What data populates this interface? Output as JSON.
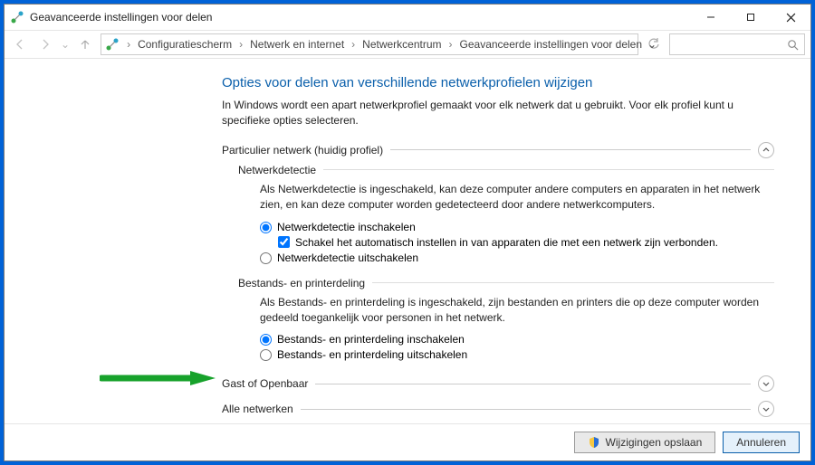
{
  "window": {
    "title": "Geavanceerde instellingen voor delen"
  },
  "breadcrumb": {
    "items": [
      "Configuratiescherm",
      "Netwerk en internet",
      "Netwerkcentrum",
      "Geavanceerde instellingen voor delen"
    ]
  },
  "page": {
    "heading": "Opties voor delen van verschillende netwerkprofielen wijzigen",
    "intro": "In Windows wordt een apart netwerkprofiel gemaakt voor elk netwerk dat u gebruikt. Voor elk profiel kunt u specifieke opties selecteren."
  },
  "profile_private": {
    "title": "Particulier netwerk (huidig profiel)",
    "expanded": true,
    "network_discovery": {
      "title": "Netwerkdetectie",
      "desc": "Als Netwerkdetectie is ingeschakeld, kan deze computer andere computers en apparaten in het netwerk zien, en kan deze computer worden gedetecteerd door andere netwerkcomputers.",
      "opt_on": "Netwerkdetectie inschakelen",
      "opt_on_checkbox": "Schakel het automatisch instellen in van apparaten die met een netwerk zijn verbonden.",
      "opt_off": "Netwerkdetectie uitschakelen",
      "selected": "on",
      "auto_setup_checked": true
    },
    "file_printer": {
      "title": "Bestands- en printerdeling",
      "desc": "Als Bestands- en printerdeling is ingeschakeld, zijn bestanden en printers die op deze computer worden gedeeld toegankelijk voor personen in het netwerk.",
      "opt_on": "Bestands- en printerdeling inschakelen",
      "opt_off": "Bestands- en printerdeling uitschakelen",
      "selected": "on"
    }
  },
  "profile_guest": {
    "title": "Gast of Openbaar",
    "expanded": false
  },
  "profile_all": {
    "title": "Alle netwerken",
    "expanded": false
  },
  "footer": {
    "save": "Wijzigingen opslaan",
    "cancel": "Annuleren"
  }
}
